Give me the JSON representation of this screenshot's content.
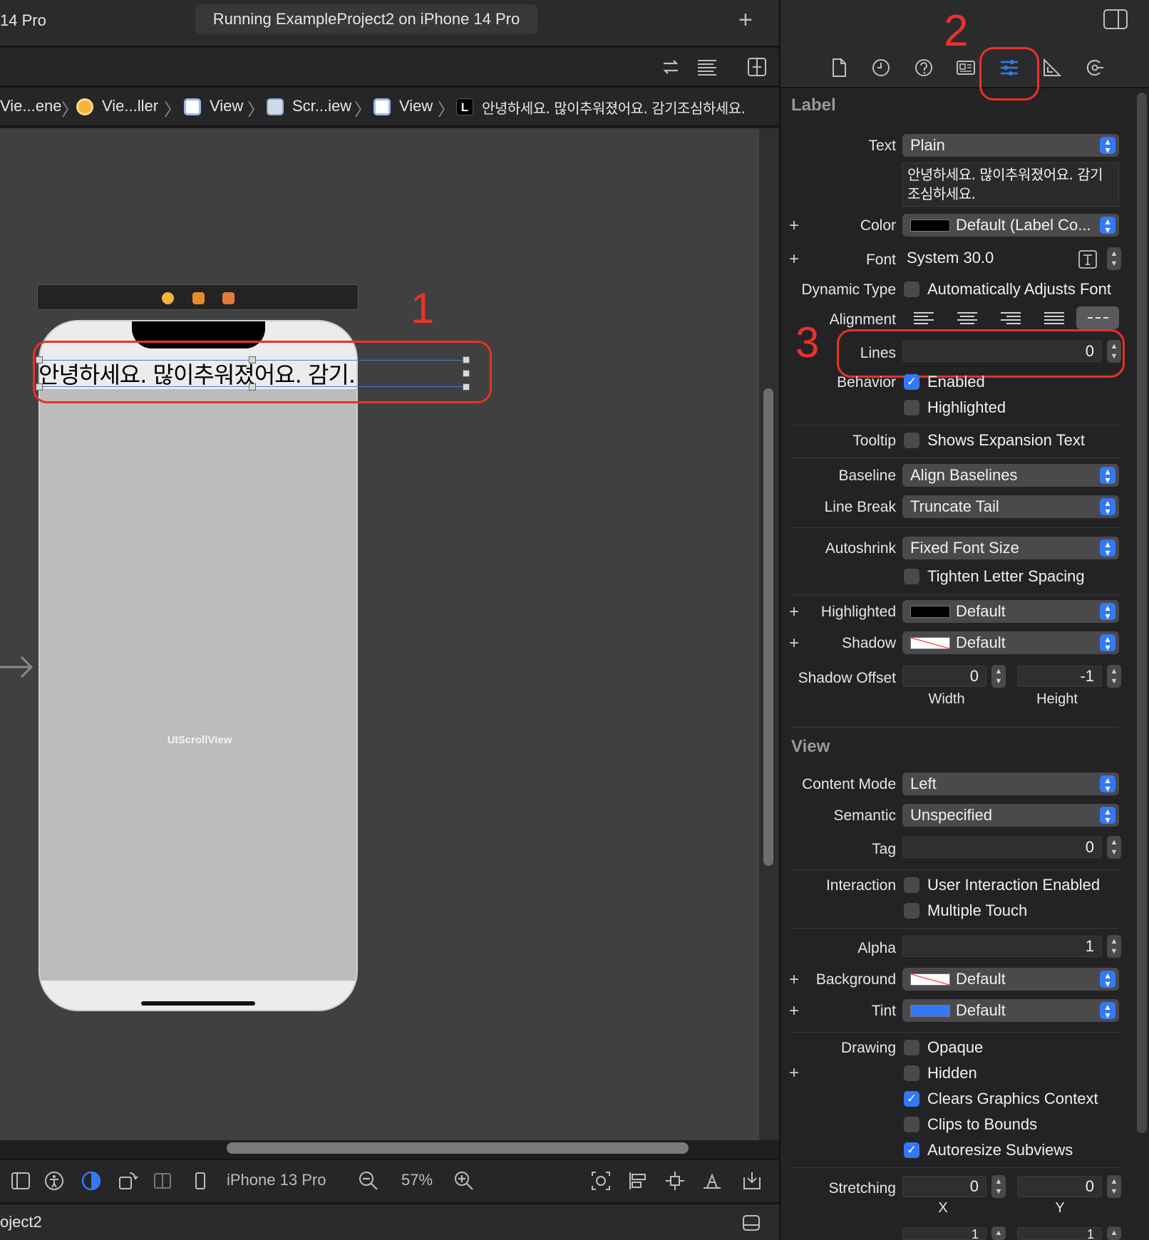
{
  "titlebar": {
    "device_fragment": "14 Pro",
    "status": "Running ExampleProject2 on iPhone 14 Pro",
    "add_label": "+"
  },
  "breadcrumb": [
    {
      "label": "Vie...ene"
    },
    {
      "label": "Vie...ller"
    },
    {
      "label": "View"
    },
    {
      "label": "Scr...iew"
    },
    {
      "label": "View"
    },
    {
      "label": "안녕하세요. 많이추워졌어요. 감기조심하세요."
    }
  ],
  "breadcrumb_icon_letter": "L",
  "canvas": {
    "label_text": "안녕하세요. 많이추워졌어요. 감기.",
    "scroll_view_label": "UIScrollView"
  },
  "annotations": {
    "one": "1",
    "two": "2",
    "three": "3"
  },
  "bottombar": {
    "device": "iPhone 13 Pro",
    "zoom": "57%"
  },
  "statusbar": {
    "project_fragment": "oject2"
  },
  "inspector": {
    "label_section": "Label",
    "text_label": "Text",
    "text_type": "Plain",
    "text_value": "안녕하세요. 많이추워졌어요. 감기조심하세요.",
    "color_label": "Color",
    "color_value": "Default (Label Co...",
    "font_label": "Font",
    "font_value": "System 30.0",
    "dynamic_type_label": "Dynamic Type",
    "dynamic_type_value": "Automatically Adjusts Font",
    "alignment_label": "Alignment",
    "lines_label": "Lines",
    "lines_value": "0",
    "behavior_label": "Behavior",
    "behavior_enabled": "Enabled",
    "behavior_highlighted": "Highlighted",
    "tooltip_label": "Tooltip",
    "tooltip_value": "Shows Expansion Text",
    "baseline_label": "Baseline",
    "baseline_value": "Align Baselines",
    "linebreak_label": "Line Break",
    "linebreak_value": "Truncate Tail",
    "autoshrink_label": "Autoshrink",
    "autoshrink_value": "Fixed Font Size",
    "tighten_value": "Tighten Letter Spacing",
    "highlighted_label": "Highlighted",
    "highlighted_value": "Default",
    "shadow_label": "Shadow",
    "shadow_value": "Default",
    "shadow_offset_label": "Shadow Offset",
    "shadow_offset_width": "0",
    "shadow_offset_height": "-1",
    "width_label": "Width",
    "height_label": "Height",
    "view_section": "View",
    "content_mode_label": "Content Mode",
    "content_mode_value": "Left",
    "semantic_label": "Semantic",
    "semantic_value": "Unspecified",
    "tag_label": "Tag",
    "tag_value": "0",
    "interaction_label": "Interaction",
    "interaction_user": "User Interaction Enabled",
    "interaction_multi": "Multiple Touch",
    "alpha_label": "Alpha",
    "alpha_value": "1",
    "background_label": "Background",
    "background_value": "Default",
    "tint_label": "Tint",
    "tint_value": "Default",
    "drawing_label": "Drawing",
    "drawing_opaque": "Opaque",
    "drawing_hidden": "Hidden",
    "drawing_clears": "Clears Graphics Context",
    "drawing_clips": "Clips to Bounds",
    "drawing_autoresize": "Autoresize Subviews",
    "stretching_label": "Stretching",
    "stretching_x": "0",
    "stretching_y": "0",
    "x_label": "X",
    "y_label": "Y",
    "stretching_w_partial": "1",
    "stretching_h_partial": "1"
  },
  "colors": {
    "accent": "#3478f6",
    "annotation": "#e8322a",
    "tint_swatch": "#3478f6"
  }
}
